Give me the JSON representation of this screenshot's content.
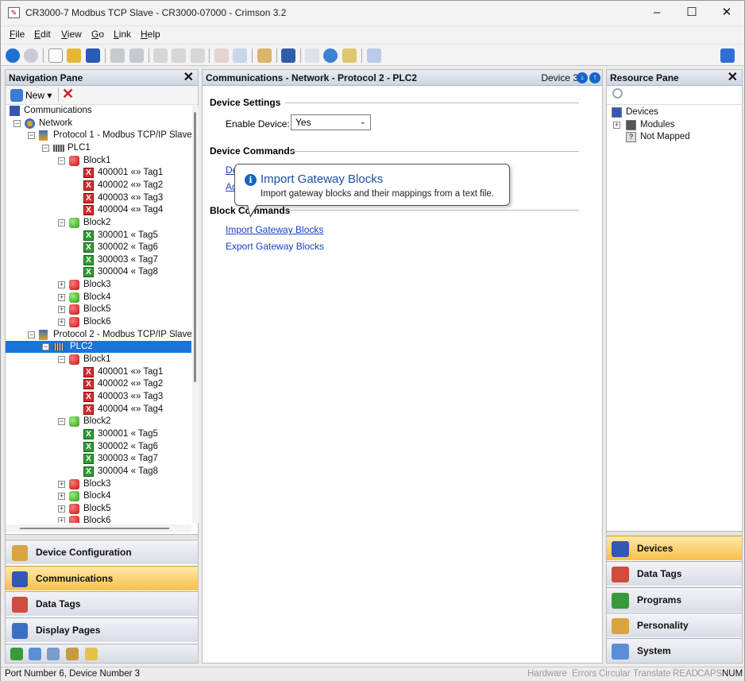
{
  "window": {
    "title": "CR3000-7 Modbus TCP Slave - CR3000-07000 - Crimson 3.2"
  },
  "menu": [
    "File",
    "Edit",
    "View",
    "Go",
    "Link",
    "Help"
  ],
  "nav": {
    "header": "Navigation Pane",
    "new_label": "New",
    "tree": [
      {
        "label": "Communications",
        "level": 0,
        "icon": "comms-icon"
      },
      {
        "label": "Network",
        "level": 1,
        "icon": "network-icon",
        "expander": "-"
      },
      {
        "label": "Protocol 1 - Modbus TCP/IP Slave",
        "level": 2,
        "icon": "protocol-icon",
        "expander": "-"
      },
      {
        "label": "PLC1",
        "level": 3,
        "icon": "plc-icon",
        "expander": "-"
      },
      {
        "label": "Block1",
        "level": 4,
        "icon": "cube-red",
        "expander": "-"
      },
      {
        "label": "400001 «» Tag1",
        "level": 5,
        "icon": "tag-red"
      },
      {
        "label": "400002 «» Tag2",
        "level": 5,
        "icon": "tag-red"
      },
      {
        "label": "400003 «» Tag3",
        "level": 5,
        "icon": "tag-red"
      },
      {
        "label": "400004 «» Tag4",
        "level": 5,
        "icon": "tag-red"
      },
      {
        "label": "Block2",
        "level": 4,
        "icon": "cube-green",
        "expander": "-"
      },
      {
        "label": "300001 « Tag5",
        "level": 5,
        "icon": "tag-green"
      },
      {
        "label": "300002 « Tag6",
        "level": 5,
        "icon": "tag-green"
      },
      {
        "label": "300003 « Tag7",
        "level": 5,
        "icon": "tag-green"
      },
      {
        "label": "300004 « Tag8",
        "level": 5,
        "icon": "tag-green"
      },
      {
        "label": "Block3",
        "level": 4,
        "icon": "cube-red",
        "expander": "+"
      },
      {
        "label": "Block4",
        "level": 4,
        "icon": "cube-green",
        "expander": "+"
      },
      {
        "label": "Block5",
        "level": 4,
        "icon": "cube-red",
        "expander": "+"
      },
      {
        "label": "Block6",
        "level": 4,
        "icon": "cube-red",
        "expander": "+"
      },
      {
        "label": "Protocol 2 - Modbus TCP/IP Slave",
        "level": 2,
        "icon": "protocol-icon",
        "expander": "-"
      },
      {
        "label": "PLC2",
        "level": 3,
        "icon": "plc-icon",
        "expander": "-",
        "selected": true
      },
      {
        "label": "Block1",
        "level": 4,
        "icon": "cube-red",
        "expander": "-"
      },
      {
        "label": "400001 «» Tag1",
        "level": 5,
        "icon": "tag-red"
      },
      {
        "label": "400002 «» Tag2",
        "level": 5,
        "icon": "tag-red"
      },
      {
        "label": "400003 «» Tag3",
        "level": 5,
        "icon": "tag-red"
      },
      {
        "label": "400004 «» Tag4",
        "level": 5,
        "icon": "tag-red"
      },
      {
        "label": "Block2",
        "level": 4,
        "icon": "cube-green",
        "expander": "-"
      },
      {
        "label": "300001 « Tag5",
        "level": 5,
        "icon": "tag-green"
      },
      {
        "label": "300002 « Tag6",
        "level": 5,
        "icon": "tag-green"
      },
      {
        "label": "300003 « Tag7",
        "level": 5,
        "icon": "tag-green"
      },
      {
        "label": "300004 « Tag8",
        "level": 5,
        "icon": "tag-green"
      },
      {
        "label": "Block3",
        "level": 4,
        "icon": "cube-red",
        "expander": "+"
      },
      {
        "label": "Block4",
        "level": 4,
        "icon": "cube-green",
        "expander": "+"
      },
      {
        "label": "Block5",
        "level": 4,
        "icon": "cube-red",
        "expander": "+"
      },
      {
        "label": "Block6",
        "level": 4,
        "icon": "cube-red",
        "expander": "+"
      }
    ],
    "categories": [
      {
        "label": "Device Configuration",
        "active": false
      },
      {
        "label": "Communications",
        "active": true
      },
      {
        "label": "Data Tags",
        "active": false
      },
      {
        "label": "Display Pages",
        "active": false
      }
    ]
  },
  "main": {
    "header": "Communications - Network - Protocol 2 - PLC2",
    "device": "Device 3",
    "device_settings_title": "Device Settings",
    "enable_label": "Enable Device:",
    "enable_value": "Yes",
    "device_commands_title": "Device Commands",
    "cmd1_partial": "De",
    "cmd2_partial": "Ad",
    "block_commands_title": "Block Commands",
    "import_link": "Import Gateway Blocks",
    "export_link": "Export Gateway Blocks",
    "tooltip_title": "Import Gateway Blocks",
    "tooltip_text": "Import gateway blocks and their mappings from a text file."
  },
  "resource": {
    "header": "Resource Pane",
    "tree": [
      {
        "label": "Devices",
        "level": 0
      },
      {
        "label": "Modules",
        "level": 1,
        "expander": "+"
      },
      {
        "label": "Not Mapped",
        "level": 1
      }
    ],
    "categories": [
      {
        "label": "Devices",
        "active": true
      },
      {
        "label": "Data Tags",
        "active": false
      },
      {
        "label": "Programs",
        "active": false
      },
      {
        "label": "Personality",
        "active": false
      },
      {
        "label": "System",
        "active": false
      }
    ]
  },
  "status": {
    "text": "Port Number 6, Device Number 3",
    "indicators": [
      {
        "label": "Hardware",
        "on": false
      },
      {
        "label": "Errors",
        "on": false
      },
      {
        "label": "Circular",
        "on": false
      },
      {
        "label": "Translate",
        "on": false
      },
      {
        "label": "READ",
        "on": false
      },
      {
        "label": "CAPS",
        "on": false
      },
      {
        "label": "NUM",
        "on": true
      }
    ]
  }
}
